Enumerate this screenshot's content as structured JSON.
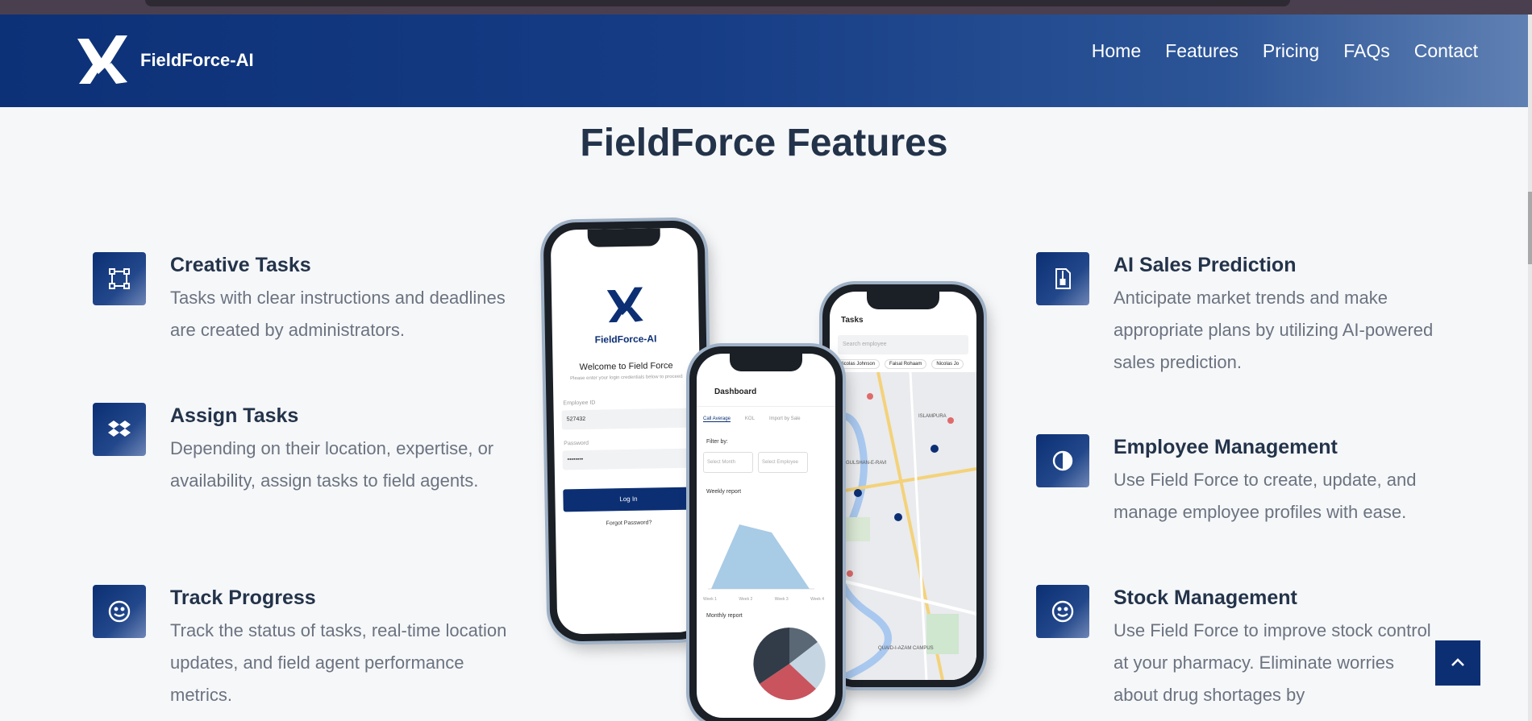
{
  "brand": {
    "name": "FieldForce-AI"
  },
  "nav": {
    "items": [
      "Home",
      "Features",
      "Pricing",
      "FAQs",
      "Contact"
    ]
  },
  "page": {
    "title": "FieldForce Features"
  },
  "features_left": [
    {
      "title": "Creative Tasks",
      "desc": "Tasks with clear instructions and deadlines are created by administrators.",
      "icon": "task-board-icon"
    },
    {
      "title": "Assign Tasks",
      "desc": "Depending on their location, expertise, or availability, assign tasks to field agents.",
      "icon": "dropbox-icon"
    },
    {
      "title": "Track Progress",
      "desc": "Track the status of tasks, real-time location updates, and field agent performance metrics.",
      "icon": "smile-icon"
    }
  ],
  "features_right": [
    {
      "title": "AI Sales Prediction",
      "desc": "Anticipate market trends and make appropriate plans by utilizing AI-powered sales prediction.",
      "icon": "file-zip-icon"
    },
    {
      "title": "Employee Management",
      "desc": "Use Field Force to create, update, and manage employee profiles with ease.",
      "icon": "contrast-icon"
    },
    {
      "title": "Stock Management",
      "desc": "Use Field Force to improve stock control at your pharmacy. Eliminate worries about drug shortages by",
      "icon": "smile-icon"
    }
  ],
  "phone_login": {
    "brand": "FieldForce-AI",
    "welcome": "Welcome to Field Force",
    "subtitle": "Please enter your login credentials below to proceed",
    "employee_label": "Employee ID",
    "employee_value": "527432",
    "password_label": "Password",
    "password_value": "••••••••",
    "login_button": "Log In",
    "forgot": "Forgot Password?"
  },
  "phone_dashboard": {
    "title": "Dashboard",
    "tabs": [
      "Call Average",
      "KOL",
      "Import by Sale"
    ],
    "filter_label": "Filter by:",
    "select_month": "Select Month",
    "select_employee": "Select Employee",
    "weekly_report": "Weekly report",
    "monthly_report": "Monthly report",
    "weeks": [
      "Week 1",
      "Week 2",
      "Week 3",
      "Week 4"
    ]
  },
  "phone_tasks": {
    "title": "Tasks",
    "search_placeholder": "Search employee",
    "chips": [
      "Nicolas Johnson",
      "Faisal Rohaam",
      "Nicolas Jo"
    ],
    "map_labels": [
      "ISLAMPURA",
      "GULSHAN-E-RAVI",
      "QUAID-I-AZAM CAMPUS"
    ]
  },
  "colors": {
    "primary": "#0c2f74",
    "heading": "#23334a",
    "text": "#6b7380"
  }
}
